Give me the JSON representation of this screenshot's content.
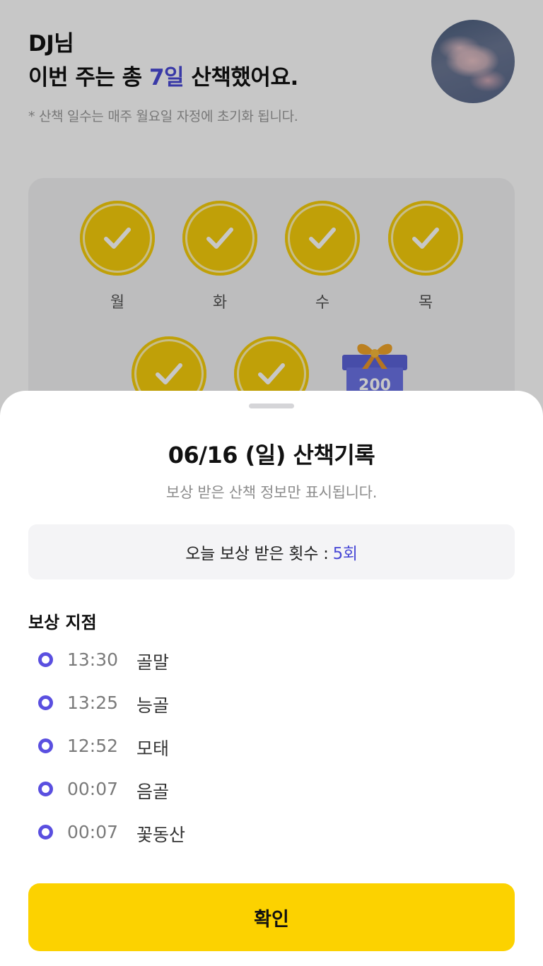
{
  "header": {
    "name": "DJ님",
    "week_prefix": "이번 주는 총 ",
    "week_days": "7일",
    "week_suffix": " 산책했어요.",
    "reset_note": "* 산책 일수는 매주 월요일 자정에 초기화 됩니다."
  },
  "week": {
    "days": [
      {
        "label": "월",
        "done": true
      },
      {
        "label": "화",
        "done": true
      },
      {
        "label": "수",
        "done": true
      },
      {
        "label": "목",
        "done": true
      },
      {
        "label": "",
        "done": true
      },
      {
        "label": "",
        "done": true
      }
    ],
    "gift_points": "200"
  },
  "sheet": {
    "title": "06/16 (일) 산책기록",
    "subtitle": "보상 받은 산책 정보만 표시됩니다.",
    "count_label": "오늘 보상 받은 횟수 :",
    "count_value": "5회",
    "section_title": "보상 지점",
    "spots": [
      {
        "time": "13:30",
        "name": "골말"
      },
      {
        "time": "13:25",
        "name": "능골"
      },
      {
        "time": "12:52",
        "name": "모태"
      },
      {
        "time": "00:07",
        "name": "음골"
      },
      {
        "time": "00:07",
        "name": "꽃동산"
      }
    ],
    "confirm_label": "확인"
  },
  "colors": {
    "accent": "#4a4ad6",
    "stamp": "#f6ce0b",
    "confirm": "#fcd200",
    "dot": "#5a4fe0"
  }
}
